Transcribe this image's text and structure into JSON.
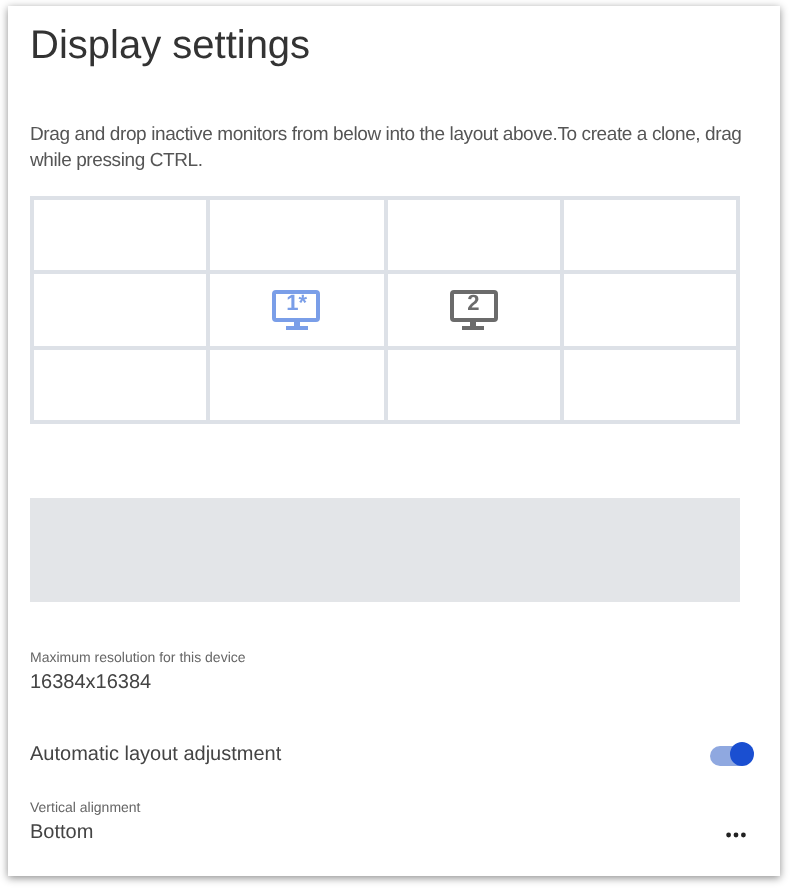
{
  "title": "Display settings",
  "instructions": "Drag and drop inactive monitors from below into the layout above.To create a clone, drag while pressing CTRL.",
  "layout_grid": [
    [
      {
        "kind": "empty"
      },
      {
        "kind": "empty"
      },
      {
        "kind": "empty"
      },
      {
        "kind": "empty"
      }
    ],
    [
      {
        "kind": "empty"
      },
      {
        "kind": "monitor",
        "label": "1*",
        "selected": true
      },
      {
        "kind": "monitor",
        "label": "2",
        "selected": false
      },
      {
        "kind": "empty"
      }
    ],
    [
      {
        "kind": "empty"
      },
      {
        "kind": "empty"
      },
      {
        "kind": "empty"
      },
      {
        "kind": "empty"
      }
    ]
  ],
  "max_resolution": {
    "label": "Maximum resolution for this device",
    "value": "16384x16384"
  },
  "auto_layout": {
    "label": "Automatic layout adjustment",
    "on": true
  },
  "vertical_alignment": {
    "label": "Vertical alignment",
    "value": "Bottom"
  }
}
